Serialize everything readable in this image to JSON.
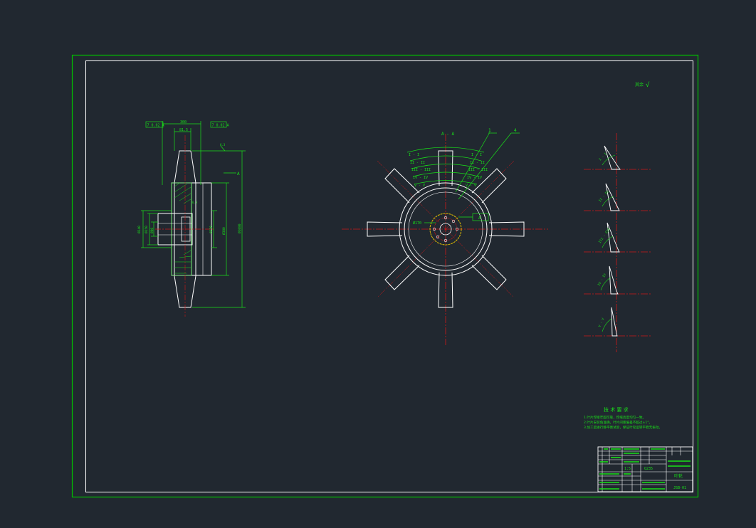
{
  "colors": {
    "background": "#212830",
    "frame_outer": "#00c000",
    "frame_inner": "#ffffff",
    "geometry": "#ffffff",
    "centerline": "#d01818",
    "annotation": "#19e019",
    "hub_outline": "#e6c000"
  },
  "side_view": {
    "dim_top_left": "7 0.02 A",
    "dim_top_center": "300",
    "dim_top_sub": "81.5",
    "dim_top_right": "7 0.02 A",
    "cut_marker": "A",
    "dim_left_1": "Ø240",
    "dim_left_2": "Ø150",
    "dim_left_3": "Ø80",
    "dim_right_1": "Ø370",
    "dim_right_2": "Ø380",
    "dim_right_3": "Ø1080",
    "roughness_1": "6.3",
    "roughness_2": "6.3"
  },
  "front_view": {
    "section_label": "A - A",
    "leader_1": "1",
    "leader_2": "4",
    "section_marks": [
      "I - I",
      "II - II",
      "III - III",
      "IV - IV",
      "V - V"
    ],
    "section_marks_right": [
      "I - I",
      "II - II",
      "III - III",
      "IV - IV",
      "V - V"
    ],
    "datum": "A",
    "hub_dim": "Ø170"
  },
  "sections": {
    "labels": [
      "I - I",
      "II - II",
      "III - III",
      "IV - IV",
      "V - V"
    ]
  },
  "roughness_note": {
    "prefix": "其余",
    "symbol": "√"
  },
  "tech_requirements": {
    "title": "技 术 要 求",
    "lines": [
      "1.叶片焊接牢固可靠，焊缝高度均匀一致。",
      "2.叶片安装角准确，叶片间距偏差不超过±1°。",
      "3.加工后进行静平衡试验，保证叶轮运转平稳无振动。"
    ]
  },
  "title_block": {
    "drawing_name": "叶轮",
    "drawing_no": "JSB-01",
    "material": "Q235",
    "scale": "1:5"
  }
}
